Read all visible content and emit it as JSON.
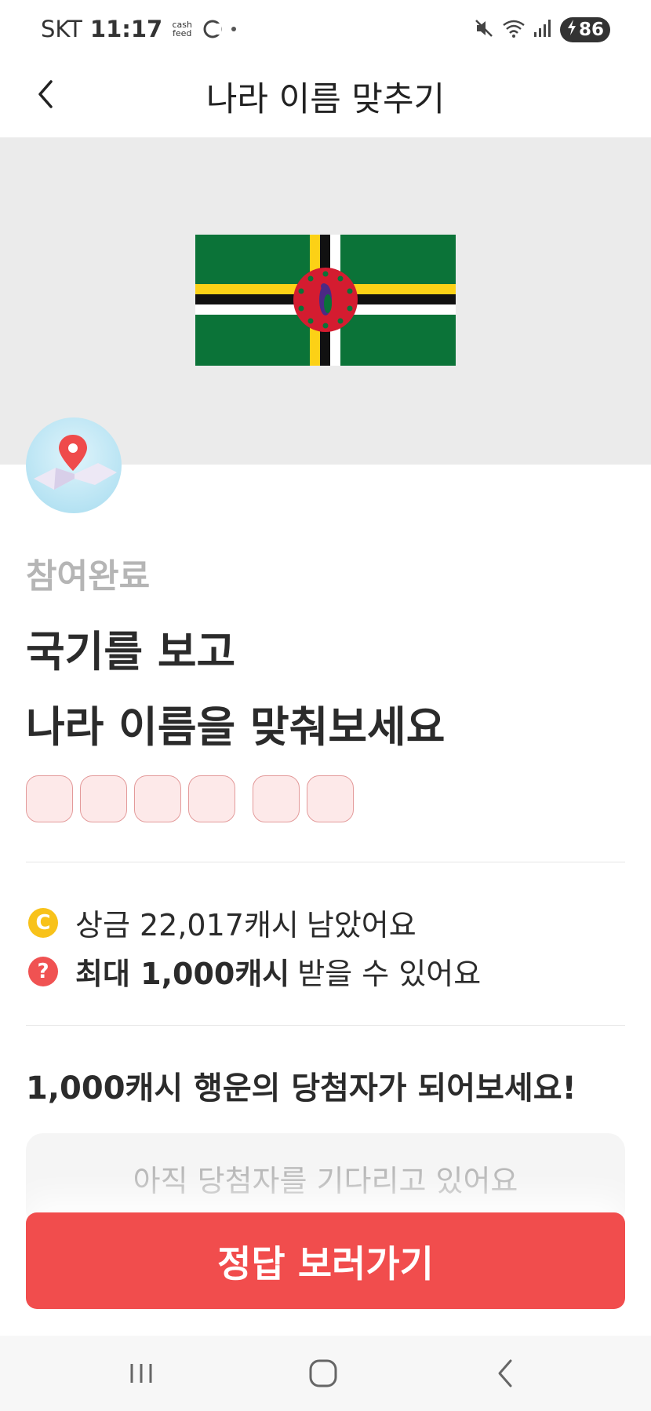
{
  "status_bar": {
    "carrier": "SKT",
    "time": "11:17",
    "app_label": "cash feed",
    "battery": "86"
  },
  "header": {
    "title": "나라 이름 맞추기"
  },
  "quiz": {
    "status": "참여완료",
    "question_line1": "국기를 보고",
    "question_line2": "나라 이름을 맞춰보세요",
    "answer_box_groups": [
      4,
      2
    ]
  },
  "info": {
    "prize_strong": "상금 22,017캐시",
    "prize_rest": "남았어요",
    "max_strong": "최대 1,000캐시",
    "max_rest": "받을 수 있어요",
    "coin_glyph": "C",
    "question_glyph": "?"
  },
  "lucky": {
    "title": "1,000캐시 행운의 당첨자가 되어보세요!",
    "winner_placeholder": "아직 당첨자를 기다리고 있어요"
  },
  "cta": {
    "label": "정답 보러가기"
  },
  "colors": {
    "accent": "#f14d4d",
    "flag_green": "#0b7338",
    "flag_yellow": "#fcd116",
    "flag_red": "#d41c30"
  },
  "icons": [
    "back-arrow-icon",
    "map-pin-icon",
    "coin-icon",
    "question-icon",
    "recents-icon",
    "home-icon",
    "nav-back-icon"
  ]
}
